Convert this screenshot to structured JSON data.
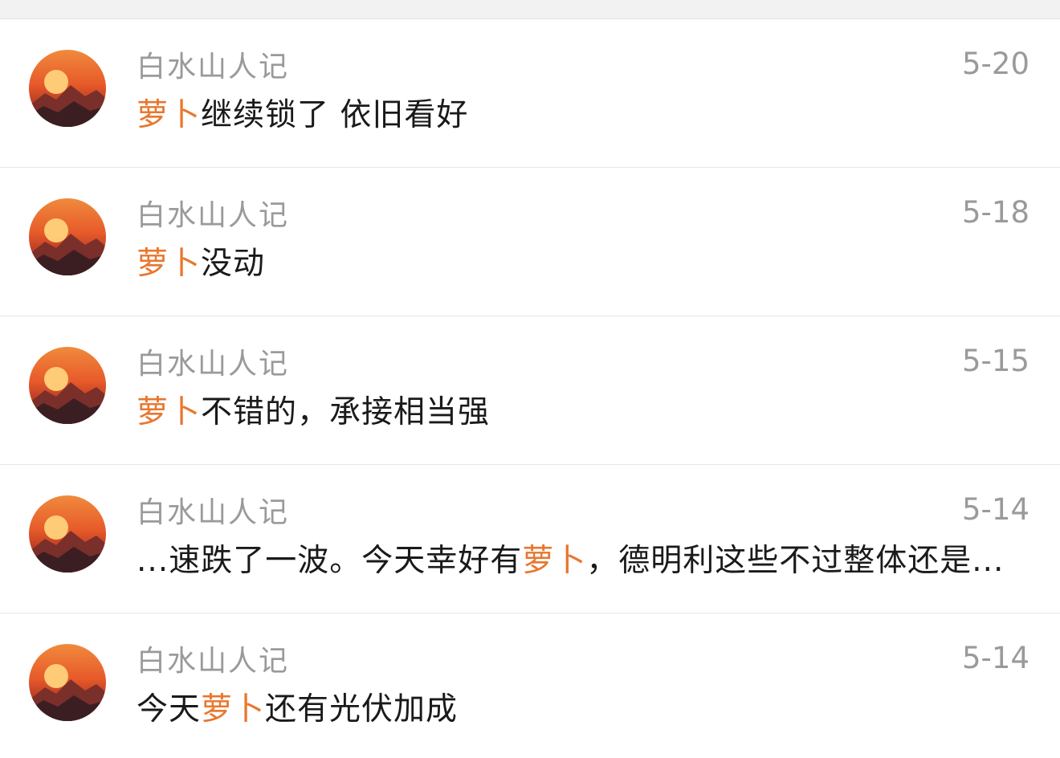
{
  "colors": {
    "highlight": "#e8772e",
    "meta_text": "#9a9a9a",
    "body_text": "#1a1a1a"
  },
  "avatar_icon": "sunset-mountain-avatar",
  "items": [
    {
      "name": "白水山人记",
      "date": "5-20",
      "content": {
        "before": "",
        "highlight": "萝卜",
        "after": "继续锁了 依旧看好"
      }
    },
    {
      "name": "白水山人记",
      "date": "5-18",
      "content": {
        "before": "",
        "highlight": "萝卜",
        "after": "没动"
      }
    },
    {
      "name": "白水山人记",
      "date": "5-15",
      "content": {
        "before": "",
        "highlight": "萝卜",
        "after": "不错的，承接相当强"
      }
    },
    {
      "name": "白水山人记",
      "date": "5-14",
      "content": {
        "before": "...速跌了一波。今天幸好有",
        "highlight": "萝卜",
        "after": "，德明利这些不过整体还是..."
      }
    },
    {
      "name": "白水山人记",
      "date": "5-14",
      "content": {
        "before": "今天",
        "highlight": "萝卜",
        "after": "还有光伏加成"
      }
    }
  ]
}
